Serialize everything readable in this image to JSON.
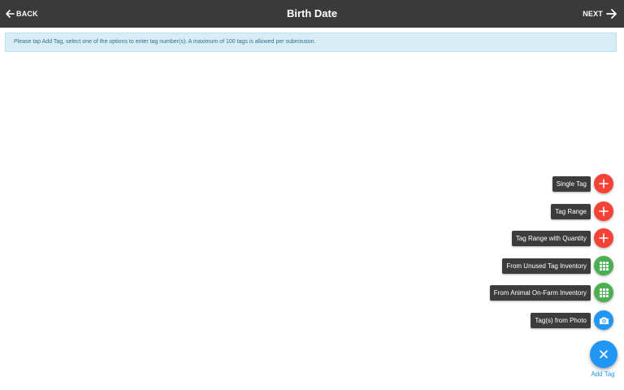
{
  "header": {
    "back_label": "BACK",
    "title": "Birth Date",
    "next_label": "NEXT",
    "background": "#3a3a3a"
  },
  "banner": {
    "text": "Please tap Add Tag, select one of the options to enter tag number(s). A maximum of 100 tags is allowed per submission."
  },
  "fab_menu": {
    "items": [
      {
        "label": "Single Tag",
        "icon": "plus-icon",
        "color": "#f44336"
      },
      {
        "label": "Tag Range",
        "icon": "plus-icon",
        "color": "#f44336"
      },
      {
        "label": "Tag Range with Quantity",
        "icon": "plus-icon",
        "color": "#f44336"
      },
      {
        "label": "From Unused Tag Inventory",
        "icon": "grid-icon",
        "color": "#4caf50"
      },
      {
        "label": "From Animal On-Farm Inventory",
        "icon": "grid-icon",
        "color": "#4caf50"
      },
      {
        "label": "Tag(s) from Photo",
        "icon": "camera-icon",
        "color": "#2196f3"
      }
    ],
    "main_label": "Add Tag",
    "main_icon": "close-icon",
    "main_color": "#2196f3"
  }
}
